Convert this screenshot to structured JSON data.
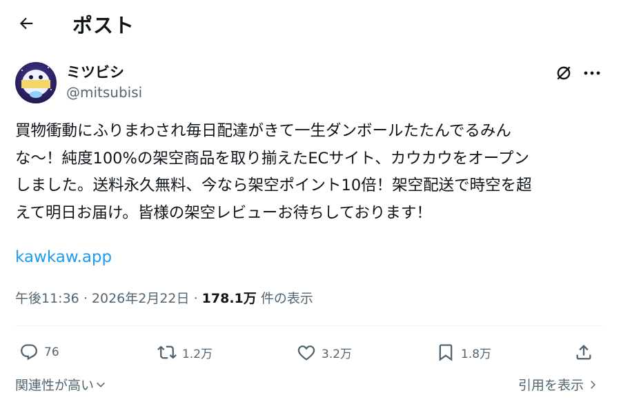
{
  "header": {
    "title": "ポスト",
    "back_icon": "arrow-left-icon"
  },
  "author": {
    "display_name": "ミツビシ",
    "handle": "@mitsubisi"
  },
  "tweet": {
    "text": "買物衝動にふりまわされ毎日配達がきて一生ダンボールたたんでるみん\nな〜！純度100%の架空商品を取り揃えたECサイト、カウカウをオープン\nしました。送料永久無料、今なら架空ポイント10倍！架空配送で時空を超\nえて明日お届け。皆様の架空レビューお待ちしております！",
    "link": "kawkaw.app"
  },
  "meta": {
    "time": "午後11:36",
    "date": "2026年2月22日",
    "views_count": "178.1万",
    "views_label": "件の表示",
    "separator": "·"
  },
  "actions": {
    "replies": "76",
    "reposts": "1.2万",
    "likes": "3.2万",
    "bookmarks": "1.8万"
  },
  "footer": {
    "sort_label": "関連性が高い",
    "quotes_label": "引用を表示"
  },
  "colors": {
    "link": "#1d9bf0",
    "secondary_text": "#536471",
    "text": "#0f1419"
  }
}
